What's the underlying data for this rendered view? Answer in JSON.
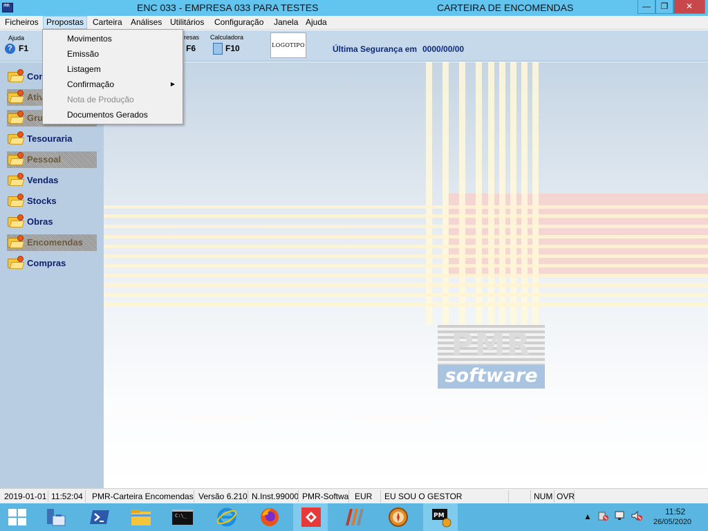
{
  "window": {
    "title_left": "ENC 033 - EMPRESA 033 PARA TESTES",
    "title_right": "CARTEIRA DE ENCOMENDAS",
    "minimize_glyph": "—",
    "maximize_glyph": "❐",
    "close_glyph": "✕"
  },
  "menubar": {
    "items": [
      "Ficheiros",
      "Propostas",
      "Carteira",
      "Análises",
      "Utilitários",
      "Configuração",
      "Janela",
      "Ajuda"
    ]
  },
  "toolbar": {
    "help_label": "Ajuda",
    "help_key": "F1",
    "help_icon_glyph": "?",
    "empresas_label": "resas",
    "empresas_key": "F6",
    "calc_label": "Calculadora",
    "calc_key": "F10",
    "logo_text": "LOGOTIPO",
    "backup_label": "Última Segurança em",
    "backup_date": "0000/00/00"
  },
  "sidebar": {
    "items": [
      {
        "label": "Contabilidade",
        "enabled": true
      },
      {
        "label": "Ativos",
        "enabled": false
      },
      {
        "label": "Gruas",
        "enabled": false
      },
      {
        "label": "Tesouraria",
        "enabled": true
      },
      {
        "label": "Pessoal",
        "enabled": false
      },
      {
        "label": "Vendas",
        "enabled": true
      },
      {
        "label": "Stocks",
        "enabled": true
      },
      {
        "label": "Obras",
        "enabled": true
      },
      {
        "label": "Encomendas",
        "enabled": false
      },
      {
        "label": "Compras",
        "enabled": true
      }
    ]
  },
  "dropdown": {
    "items": [
      {
        "label": "Movimentos",
        "enabled": true,
        "submenu": false
      },
      {
        "label": "Emissão",
        "enabled": true,
        "submenu": false
      },
      {
        "label": "Listagem",
        "enabled": true,
        "submenu": false
      },
      {
        "label": "Confirmação",
        "enabled": true,
        "submenu": true
      },
      {
        "label": "Nota de Produção",
        "enabled": false,
        "submenu": false
      },
      {
        "label": "Documentos Gerados",
        "enabled": true,
        "submenu": false
      }
    ],
    "submenu_glyph": "▶"
  },
  "logo": {
    "top_text": "PMR",
    "bottom_text": "software"
  },
  "statusbar": {
    "date": "2019-01-01",
    "time": "11:52:04",
    "app": "PMR-Carteira Encomendas",
    "version": "Versão  6.210",
    "install": "N.Inst.99000",
    "vendor": "PMR-Softwar",
    "currency": "EUR",
    "user": "EU SOU O GESTOR",
    "num": "NUM",
    "ovr": "OVR"
  },
  "taskbar": {
    "clock_time": "11:52",
    "clock_date": "26/05/2020",
    "tray_chevron": "▲",
    "cmd_glyph": "C:\\_"
  }
}
